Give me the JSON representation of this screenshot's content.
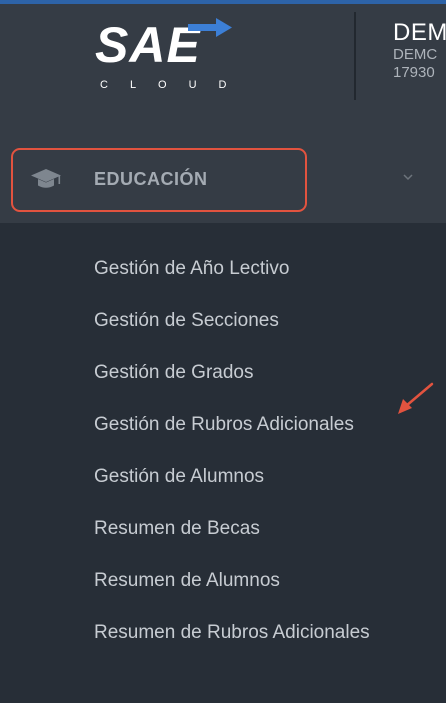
{
  "logo": {
    "alt": "SAE CLOUD",
    "wordmark": "SAE",
    "subtext": "CLOUD"
  },
  "company": {
    "name": "DEM",
    "line1": "DEMC",
    "line2": "17930"
  },
  "menu": {
    "icon": "graduation-cap-icon",
    "label": "EDUCACIÓN",
    "expanded": true,
    "items": [
      {
        "label": "Gestión de Año Lectivo"
      },
      {
        "label": "Gestión de Secciones"
      },
      {
        "label": "Gestión de Grados"
      },
      {
        "label": "Gestión de Rubros Adicionales"
      },
      {
        "label": "Gestión de Alumnos"
      },
      {
        "label": "Resumen de Becas"
      },
      {
        "label": "Resumen de Alumnos"
      },
      {
        "label": "Resumen de Rubros Adicionales"
      }
    ]
  },
  "annotations": {
    "highlight_color": "#e2533f",
    "arrow_color": "#e2533f"
  },
  "colors": {
    "sidebar_bg": "#272e37",
    "header_bg": "#353c45",
    "accent": "#2d63a8"
  }
}
